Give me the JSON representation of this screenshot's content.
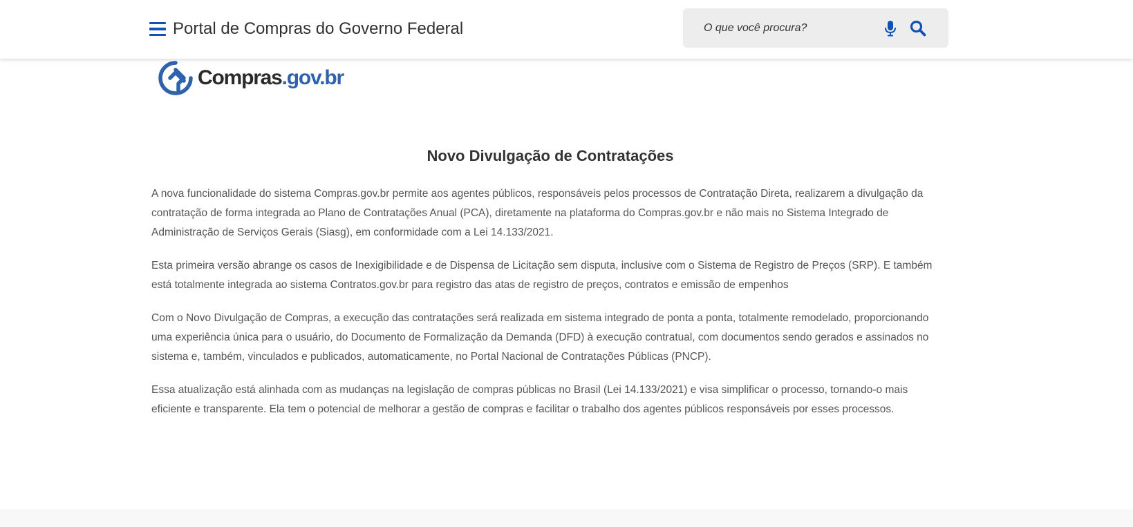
{
  "header": {
    "title": "Portal de Compras do Governo Federal",
    "search": {
      "placeholder": "O que você procura?",
      "value": ""
    }
  },
  "logo": {
    "text_main": "Compras",
    "text_accent": ".gov.br"
  },
  "main": {
    "title": "Novo Divulgação de Contratações",
    "paragraphs": [
      "A nova funcionalidade do sistema Compras.gov.br permite aos agentes públicos, responsáveis pelos processos de Contratação Direta, realizarem a divulgação da contratação de forma integrada ao Plano de Contratações Anual (PCA), diretamente na plataforma do Compras.gov.br e não mais no Sistema Integrado de Administração de Serviços Gerais (Siasg), em conformidade com a Lei 14.133/2021.",
      "Esta primeira versão abrange os casos de Inexigibilidade e de Dispensa de Licitação sem disputa, inclusive com o Sistema de Registro de Preços (SRP). E também está totalmente integrada ao sistema Contratos.gov.br para registro das atas de registro de preços, contratos e emissão de empenhos",
      "Com o Novo Divulgação de Compras, a execução das contratações será realizada em sistema integrado de ponta a ponta, totalmente remodelado, proporcionando uma experiência única para o usuário, do Documento de Formalização da Demanda (DFD) à execução contratual, com documentos sendo gerados e assinados no sistema e, também, vinculados e publicados, automaticamente, no Portal Nacional de Contratações Públicas (PNCP).",
      "Essa atualização está alinhada com as mudanças na legislação de compras públicas no Brasil (Lei 14.133/2021) e visa simplificar o processo, tornando-o mais eficiente e transparente. Ela tem o potencial de melhorar a gestão de compras e facilitar o trabalho dos agentes públicos responsáveis por esses processos."
    ]
  },
  "icons": {
    "menu": "hamburger-menu-icon",
    "mic": "microphone-icon",
    "search": "search-icon",
    "logo": "compras-logo-icon"
  },
  "colors": {
    "primary_blue": "#1351b4",
    "logo_blue": "#2e62ad",
    "text_dark": "#333333",
    "text_body": "#555555",
    "search_bg": "#ededed"
  }
}
